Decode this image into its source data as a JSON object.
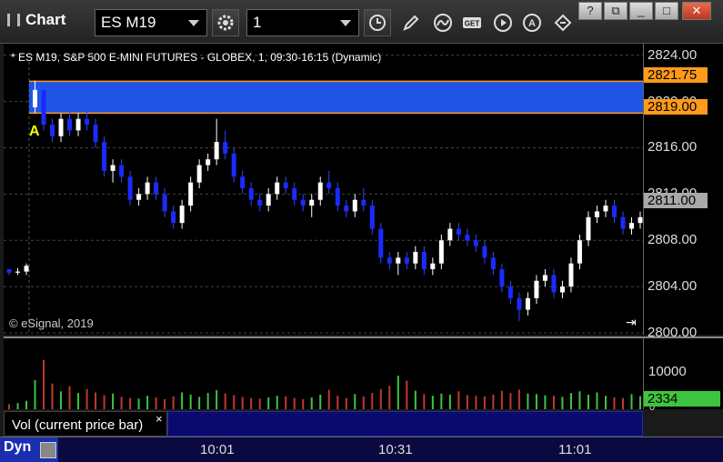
{
  "window": {
    "title": "Chart",
    "symbol": "ES M19",
    "interval": "1"
  },
  "legend": "* ES M19, S&P 500 E-MINI FUTURES - GLOBEX, 1, 09:30-16:15 (Dynamic)",
  "watermark": "© eSignal, 2019",
  "marker": "A",
  "price_axis": [
    "2824.00",
    "2820.00",
    "2816.00",
    "2812.00",
    "2808.00",
    "2804.00",
    "2800.00"
  ],
  "price_tags": {
    "upper": "2821.75",
    "lower": "2819.00",
    "last": "2811.00"
  },
  "volume": {
    "panel_label": "Vol (current price bar)",
    "axis_label": "10000",
    "axis_zero": "0",
    "last": "2334",
    "close_symbol": "×"
  },
  "time_axis": [
    "10:01",
    "10:31",
    "11:01"
  ],
  "bottom": {
    "mode": "Dyn"
  },
  "colors": {
    "zone": "#1f55e6",
    "up": "#ffffff",
    "down": "#1a2bff",
    "tag_orange": "#ff9a1a",
    "tag_last": "#a9a9a9",
    "vol_green": "#3ec43e"
  },
  "chart_data": {
    "type": "candlestick",
    "ylim": [
      2800,
      2825
    ],
    "zone": [
      2819.0,
      2821.75
    ],
    "candles": [
      [
        2805.5,
        2805.5,
        2805.0,
        2805.2
      ],
      [
        2805.2,
        2805.6,
        2805.0,
        2805.3
      ],
      [
        2805.3,
        2806.0,
        2805.0,
        2805.8
      ],
      [
        2819.5,
        2821.8,
        2819.0,
        2821.0
      ],
      [
        2821.0,
        2821.5,
        2817.5,
        2818.0
      ],
      [
        2818.0,
        2818.5,
        2816.5,
        2817.0
      ],
      [
        2817.0,
        2819.0,
        2816.5,
        2818.5
      ],
      [
        2818.5,
        2819.2,
        2817.0,
        2817.5
      ],
      [
        2817.5,
        2819.0,
        2817.0,
        2818.5
      ],
      [
        2818.5,
        2819.5,
        2817.5,
        2818.0
      ],
      [
        2818.0,
        2818.5,
        2816.0,
        2816.5
      ],
      [
        2816.5,
        2817.0,
        2813.5,
        2814.0
      ],
      [
        2814.0,
        2815.0,
        2813.0,
        2814.5
      ],
      [
        2814.5,
        2815.0,
        2813.0,
        2813.5
      ],
      [
        2813.5,
        2814.0,
        2811.0,
        2811.5
      ],
      [
        2811.5,
        2812.5,
        2811.0,
        2812.0
      ],
      [
        2812.0,
        2813.5,
        2811.5,
        2813.0
      ],
      [
        2813.0,
        2813.5,
        2811.5,
        2812.0
      ],
      [
        2812.0,
        2812.5,
        2810.0,
        2810.5
      ],
      [
        2810.5,
        2811.0,
        2809.0,
        2809.5
      ],
      [
        2809.5,
        2811.5,
        2809.0,
        2811.0
      ],
      [
        2811.0,
        2813.5,
        2810.5,
        2813.0
      ],
      [
        2813.0,
        2815.0,
        2812.5,
        2814.5
      ],
      [
        2814.5,
        2815.5,
        2814.0,
        2815.0
      ],
      [
        2815.0,
        2818.5,
        2814.5,
        2816.5
      ],
      [
        2816.5,
        2817.5,
        2815.0,
        2815.5
      ],
      [
        2815.5,
        2816.0,
        2813.0,
        2813.5
      ],
      [
        2813.5,
        2814.0,
        2812.0,
        2812.5
      ],
      [
        2812.5,
        2813.0,
        2811.0,
        2811.5
      ],
      [
        2811.5,
        2812.0,
        2810.5,
        2811.0
      ],
      [
        2811.0,
        2812.5,
        2810.5,
        2812.0
      ],
      [
        2812.0,
        2813.5,
        2811.5,
        2813.0
      ],
      [
        2813.0,
        2813.5,
        2812.0,
        2812.5
      ],
      [
        2812.5,
        2813.0,
        2811.0,
        2811.5
      ],
      [
        2811.5,
        2812.0,
        2810.5,
        2811.0
      ],
      [
        2811.0,
        2812.0,
        2810.0,
        2811.5
      ],
      [
        2811.5,
        2813.5,
        2811.0,
        2813.0
      ],
      [
        2813.0,
        2814.0,
        2812.0,
        2812.5
      ],
      [
        2812.5,
        2813.0,
        2810.5,
        2811.0
      ],
      [
        2811.0,
        2811.5,
        2810.0,
        2810.5
      ],
      [
        2810.5,
        2812.0,
        2810.0,
        2811.5
      ],
      [
        2811.5,
        2812.5,
        2810.5,
        2811.0
      ],
      [
        2811.0,
        2811.5,
        2808.5,
        2809.0
      ],
      [
        2809.0,
        2809.5,
        2806.0,
        2806.5
      ],
      [
        2806.5,
        2807.0,
        2805.5,
        2806.0
      ],
      [
        2806.0,
        2807.0,
        2805.0,
        2806.5
      ],
      [
        2806.5,
        2807.0,
        2805.5,
        2806.0
      ],
      [
        2806.0,
        2807.5,
        2805.5,
        2807.0
      ],
      [
        2807.0,
        2807.5,
        2805.0,
        2805.5
      ],
      [
        2805.5,
        2806.5,
        2805.0,
        2806.0
      ],
      [
        2806.0,
        2808.5,
        2805.5,
        2808.0
      ],
      [
        2808.0,
        2809.5,
        2807.5,
        2809.0
      ],
      [
        2809.0,
        2809.5,
        2808.0,
        2808.5
      ],
      [
        2808.5,
        2809.0,
        2807.5,
        2808.0
      ],
      [
        2808.0,
        2808.5,
        2807.0,
        2807.5
      ],
      [
        2807.5,
        2808.0,
        2806.0,
        2806.5
      ],
      [
        2806.5,
        2807.0,
        2805.0,
        2805.5
      ],
      [
        2805.5,
        2806.0,
        2803.5,
        2804.0
      ],
      [
        2804.0,
        2804.5,
        2802.5,
        2803.0
      ],
      [
        2803.0,
        2803.5,
        2801.0,
        2802.0
      ],
      [
        2802.0,
        2803.5,
        2801.5,
        2803.0
      ],
      [
        2803.0,
        2805.0,
        2802.5,
        2804.5
      ],
      [
        2804.5,
        2805.5,
        2804.0,
        2805.0
      ],
      [
        2805.0,
        2805.5,
        2803.0,
        2803.5
      ],
      [
        2803.5,
        2804.5,
        2803.0,
        2804.0
      ],
      [
        2804.0,
        2806.5,
        2803.5,
        2806.0
      ],
      [
        2806.0,
        2808.5,
        2805.5,
        2808.0
      ],
      [
        2808.0,
        2810.5,
        2807.5,
        2810.0
      ],
      [
        2810.0,
        2811.0,
        2809.5,
        2810.5
      ],
      [
        2810.5,
        2811.5,
        2810.0,
        2811.0
      ],
      [
        2811.0,
        2811.5,
        2809.5,
        2810.0
      ],
      [
        2810.0,
        2810.5,
        2808.5,
        2809.0
      ],
      [
        2809.0,
        2810.0,
        2808.5,
        2809.5
      ],
      [
        2809.5,
        2810.5,
        2809.0,
        2810.0
      ]
    ],
    "volume_max": 12000,
    "volumes": [
      900,
      1100,
      1500,
      5200,
      8800,
      4600,
      3200,
      4100,
      2900,
      3600,
      3000,
      2500,
      2800,
      2200,
      2000,
      1900,
      2400,
      2100,
      1800,
      2300,
      3000,
      2600,
      2200,
      2900,
      3400,
      2800,
      2500,
      2200,
      2000,
      1900,
      2100,
      2400,
      2300,
      2000,
      1800,
      2100,
      2600,
      3500,
      2400,
      2000,
      2700,
      2300,
      2900,
      3600,
      4200,
      6000,
      5100,
      3300,
      2700,
      2400,
      2800,
      2600,
      3200,
      2500,
      2400,
      2300,
      2600,
      3300,
      2900,
      3500,
      2800,
      2700,
      2500,
      2400,
      2200,
      2900,
      3200,
      2600,
      3000,
      2400,
      2100,
      2000,
      2700,
      2334
    ]
  }
}
